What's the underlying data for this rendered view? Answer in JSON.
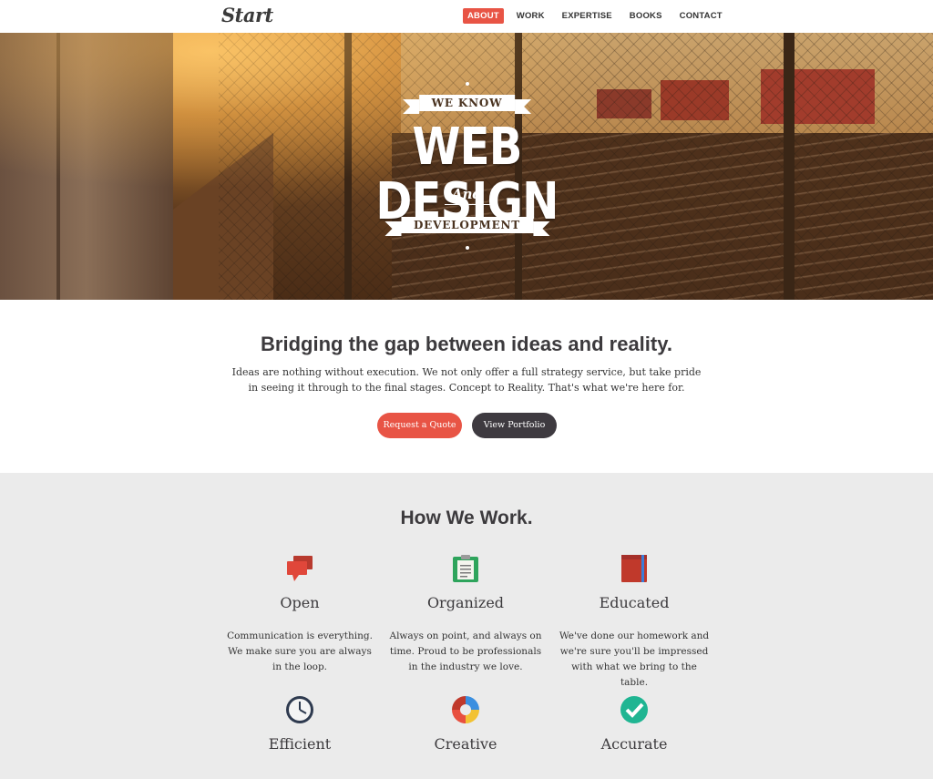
{
  "nav": {
    "logo": "Start",
    "items": [
      {
        "label": "ABOUT",
        "active": true
      },
      {
        "label": "WORK",
        "active": false
      },
      {
        "label": "EXPERTISE",
        "active": false
      },
      {
        "label": "BOOKS",
        "active": false
      },
      {
        "label": "CONTACT",
        "active": false
      }
    ]
  },
  "hero": {
    "ribbon_top": "WE KNOW",
    "headline": "WEB DESIGN",
    "connector": "And",
    "ribbon_bottom": "DEVELOPMENT"
  },
  "intro": {
    "heading": "Bridging the gap between ideas and reality.",
    "body": "Ideas are nothing without execution. We not only offer a full strategy service, but take pride in seeing it through to the final stages. Concept to Reality. That's what we're here for.",
    "primary_button": "Request a Quote",
    "secondary_button": "View Portfolio"
  },
  "how": {
    "heading": "How We Work.",
    "features": [
      {
        "title": "Open",
        "icon": "speech-bubbles-icon",
        "description": "Communication is everything. We make sure you are always in the loop."
      },
      {
        "title": "Organized",
        "icon": "clipboard-icon",
        "description": "Always on point, and always on time. Proud to be professionals in the industry we love."
      },
      {
        "title": "Educated",
        "icon": "book-icon",
        "description": "We've done our homework and we're sure you'll be impressed with what we bring to the table."
      },
      {
        "title": "Efficient",
        "icon": "clock-icon",
        "description": ""
      },
      {
        "title": "Creative",
        "icon": "color-wheel-icon",
        "description": ""
      },
      {
        "title": "Accurate",
        "icon": "check-badge-icon",
        "description": ""
      }
    ]
  },
  "colors": {
    "accent": "#e85445",
    "dark_button": "#3e3a40",
    "section_bg": "#ebebeb"
  }
}
